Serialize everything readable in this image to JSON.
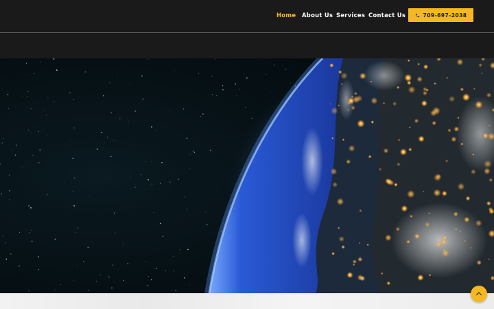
{
  "nav": {
    "items": [
      {
        "label": "Home",
        "active": true
      },
      {
        "label": "About Us",
        "active": false
      },
      {
        "label": "Services",
        "active": false
      },
      {
        "label": "Contact Us",
        "active": false
      }
    ],
    "phone": "709-697-2038",
    "phone_icon": "phone-icon"
  },
  "hero": {
    "image": "earth-from-space-night"
  },
  "scroll_top": {
    "icon": "chevron-up-icon"
  },
  "colors": {
    "accent": "#f5b820",
    "header_bg": "#1b1a1b",
    "nav_text": "#ffffff",
    "nav_active": "#f7b733"
  }
}
